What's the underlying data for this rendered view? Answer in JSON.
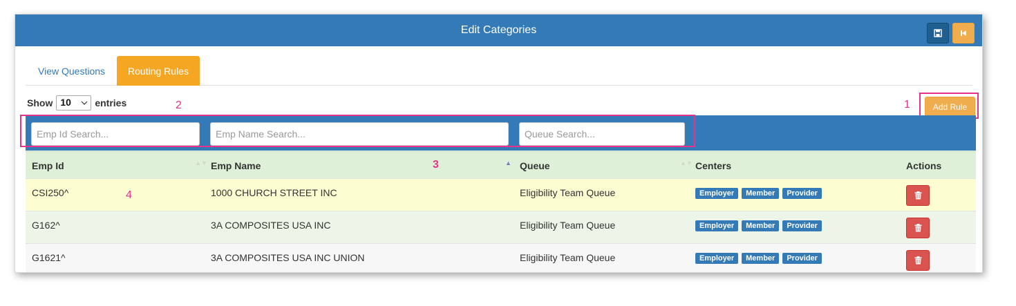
{
  "window": {
    "title": "Edit Categories",
    "buttons": [
      {
        "name": "save",
        "icon": "floppy-icon"
      },
      {
        "name": "back",
        "icon": "skip-back-icon"
      }
    ]
  },
  "tabs": [
    {
      "label": "View Questions",
      "active": false
    },
    {
      "label": "Routing Rules",
      "active": true
    }
  ],
  "length_control": {
    "prefix": "Show",
    "value": "10",
    "suffix": "entries"
  },
  "add_rule": {
    "label": "Add Rule"
  },
  "search": {
    "emp_id_placeholder": "Emp Id Search...",
    "emp_name_placeholder": "Emp Name Search...",
    "queue_placeholder": "Queue Search..."
  },
  "annotations": {
    "one": "1",
    "two": "2",
    "three": "3",
    "four": "4"
  },
  "table": {
    "headers": {
      "emp_id": "Emp Id",
      "emp_name": "Emp Name",
      "queue": "Queue",
      "centers": "Centers",
      "actions": "Actions"
    },
    "rows": [
      {
        "emp_id": "CSI250^",
        "emp_name": "1000 CHURCH STREET INC",
        "queue": "Eligibility Team Queue",
        "centers": [
          "Employer",
          "Member",
          "Provider"
        ]
      },
      {
        "emp_id": "G162^",
        "emp_name": "3A COMPOSITES USA INC",
        "queue": "Eligibility Team Queue",
        "centers": [
          "Employer",
          "Member",
          "Provider"
        ]
      },
      {
        "emp_id": "G1621^",
        "emp_name": "3A COMPOSITES USA INC UNION",
        "queue": "Eligibility Team Queue",
        "centers": [
          "Employer",
          "Member",
          "Provider"
        ]
      }
    ]
  },
  "colors": {
    "header_blue": "#337ab7",
    "accent_orange": "#f0ad4e",
    "table_header_green": "#dff0d8",
    "highlight_row": "#fcfdd1",
    "delete_red": "#d9534f",
    "annotation_pink": "#e8318a"
  }
}
